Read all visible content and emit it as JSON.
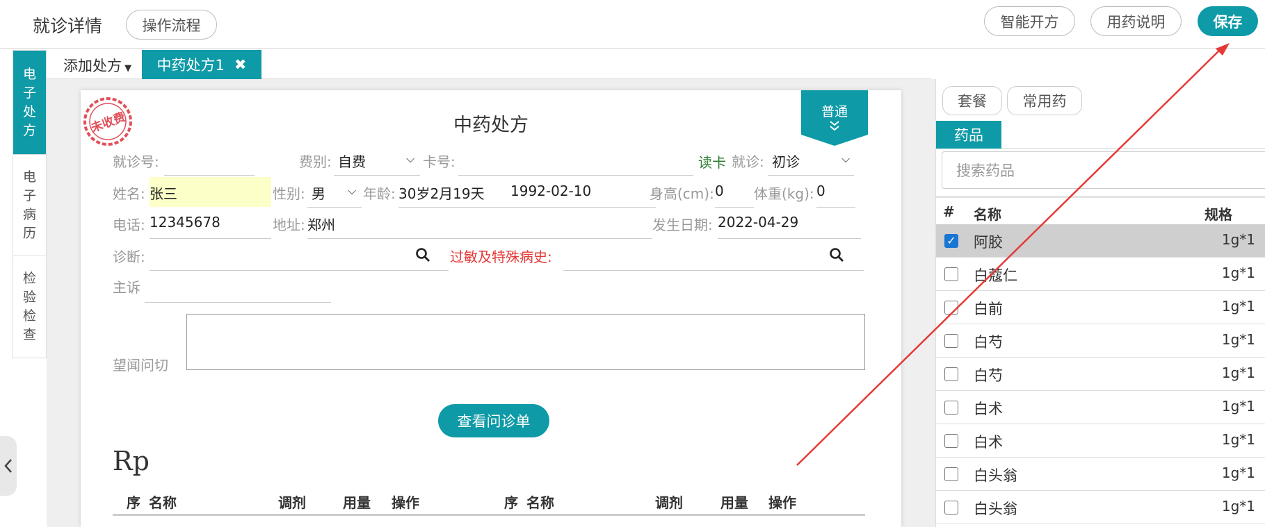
{
  "header": {
    "title": "就诊详情",
    "process_button": "操作流程",
    "smart_rx_button": "智能开方",
    "drug_usage_button": "用药说明",
    "save_button": "保存"
  },
  "sidebar": {
    "tabs": [
      {
        "label": "电子处方",
        "chars": [
          "电",
          "子",
          "处",
          "方"
        ],
        "active": true
      },
      {
        "label": "电子病历",
        "chars": [
          "电",
          "子",
          "病",
          "历"
        ],
        "active": false
      },
      {
        "label": "检验检查",
        "chars": [
          "检",
          "验",
          "检",
          "查"
        ],
        "active": false
      }
    ]
  },
  "tabbar": {
    "add_label": "添加处方",
    "active_tab": "中药处方1"
  },
  "prescription": {
    "stamp": "未收费",
    "title": "中药处方",
    "type": "普通",
    "fields": {
      "visit_no_label": "就诊号:",
      "fee_type_label": "费别:",
      "fee_type_value": "自费",
      "card_no_label": "卡号:",
      "read_card": "读卡",
      "visit_label": "就诊:",
      "visit_value": "初诊",
      "name_label": "姓名:",
      "name_value": "张三",
      "gender_label": "性别:",
      "gender_value": "男",
      "age_label": "年龄:",
      "age_value": "30岁2月19天",
      "birthdate_value": "1992-02-10",
      "height_label": "身高(cm):",
      "height_value": "0",
      "weight_label": "体重(kg):",
      "weight_value": "0",
      "phone_label": "电话:",
      "phone_value": "12345678",
      "address_label": "地址:",
      "address_value": "郑州",
      "onset_label": "发生日期:",
      "onset_value": "2022-04-29",
      "diagnosis_label": "诊断:",
      "allergy_label": "过敏及特殊病史:",
      "complaint_label": "主诉",
      "exam_label": "望闻问切"
    },
    "view_button": "查看问诊单",
    "rp": "Rp",
    "columns": [
      "序",
      "名称",
      "调剂",
      "用量",
      "操作",
      "序",
      "名称",
      "调剂",
      "用量",
      "操作"
    ]
  },
  "right_panel": {
    "package_button": "套餐",
    "common_button": "常用药",
    "drug_tab": "药品",
    "search_placeholder": "搜索药品",
    "headers": {
      "index": "#",
      "name": "名称",
      "spec": "规格"
    },
    "drugs": [
      {
        "name": "阿胶",
        "spec": "1g*1",
        "checked": true
      },
      {
        "name": "白蔻仁",
        "spec": "1g*1",
        "checked": false
      },
      {
        "name": "白前",
        "spec": "1g*1",
        "checked": false
      },
      {
        "name": "白芍",
        "spec": "1g*1",
        "checked": false
      },
      {
        "name": "白芍",
        "spec": "1g*1",
        "checked": false
      },
      {
        "name": "白术",
        "spec": "1g*1",
        "checked": false
      },
      {
        "name": "白术",
        "spec": "1g*1",
        "checked": false
      },
      {
        "name": "白头翁",
        "spec": "1g*1",
        "checked": false
      },
      {
        "name": "白头翁",
        "spec": "1g*1",
        "checked": false
      }
    ]
  },
  "colors": {
    "accent": "#0e9aa7",
    "annotation_arrow": "#e53935"
  }
}
